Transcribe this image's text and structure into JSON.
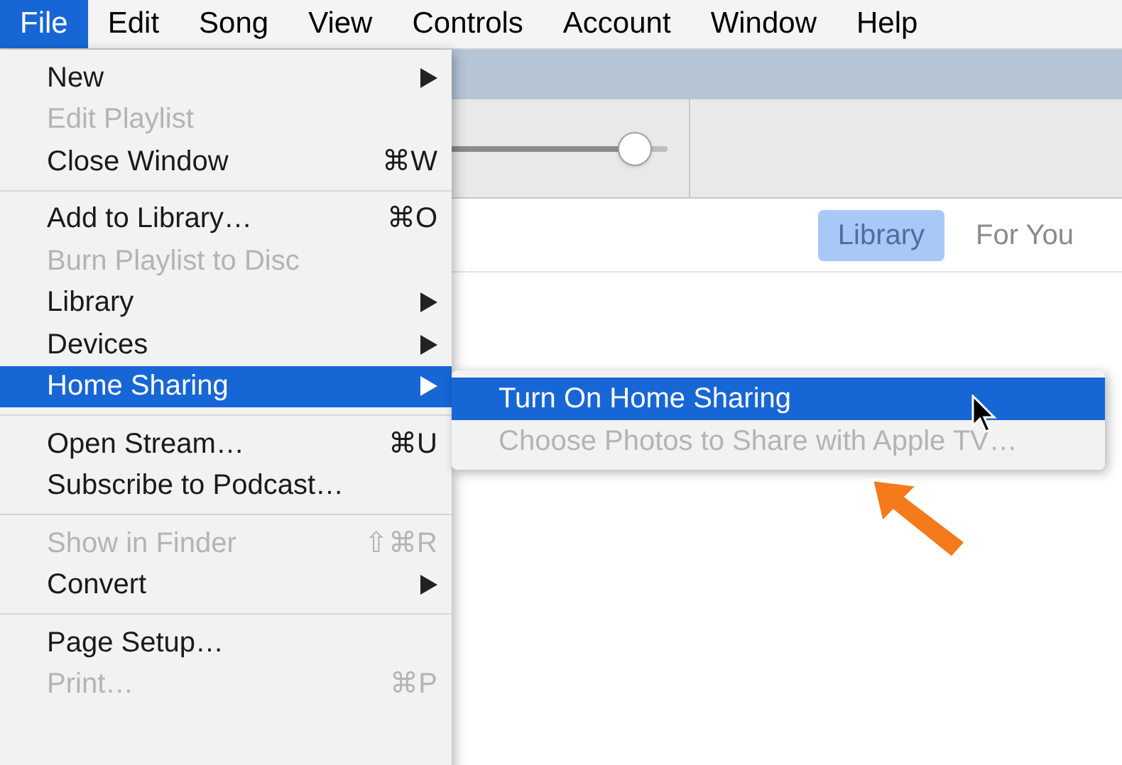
{
  "menubar": [
    {
      "label": "File",
      "selected": true
    },
    {
      "label": "Edit",
      "selected": false
    },
    {
      "label": "Song",
      "selected": false
    },
    {
      "label": "View",
      "selected": false
    },
    {
      "label": "Controls",
      "selected": false
    },
    {
      "label": "Account",
      "selected": false
    },
    {
      "label": "Window",
      "selected": false
    },
    {
      "label": "Help",
      "selected": false
    }
  ],
  "toolbar": {
    "volume": {
      "level": 0.92
    }
  },
  "tabs": [
    {
      "label": "Library",
      "selected": true
    },
    {
      "label": "For You",
      "selected": false
    }
  ],
  "file_menu": {
    "groups": [
      [
        {
          "label": "New",
          "has_submenu": true,
          "disabled": false,
          "selected": false
        },
        {
          "label": "Edit Playlist",
          "has_submenu": false,
          "disabled": true,
          "selected": false
        },
        {
          "label": "Close Window",
          "shortcut": "⌘W",
          "has_submenu": false,
          "disabled": false,
          "selected": false
        }
      ],
      [
        {
          "label": "Add to Library…",
          "shortcut": "⌘O",
          "has_submenu": false,
          "disabled": false,
          "selected": false
        },
        {
          "label": "Burn Playlist to Disc",
          "has_submenu": false,
          "disabled": true,
          "selected": false
        },
        {
          "label": "Library",
          "has_submenu": true,
          "disabled": false,
          "selected": false
        },
        {
          "label": "Devices",
          "has_submenu": true,
          "disabled": false,
          "selected": false
        },
        {
          "label": "Home Sharing",
          "has_submenu": true,
          "disabled": false,
          "selected": true
        }
      ],
      [
        {
          "label": "Open Stream…",
          "shortcut": "⌘U",
          "has_submenu": false,
          "disabled": false,
          "selected": false
        },
        {
          "label": "Subscribe to Podcast…",
          "has_submenu": false,
          "disabled": false,
          "selected": false
        }
      ],
      [
        {
          "label": "Show in Finder",
          "shortcut": "⇧⌘R",
          "has_submenu": false,
          "disabled": true,
          "selected": false
        },
        {
          "label": "Convert",
          "has_submenu": true,
          "disabled": false,
          "selected": false
        }
      ],
      [
        {
          "label": "Page Setup…",
          "has_submenu": false,
          "disabled": false,
          "selected": false
        },
        {
          "label": "Print…",
          "shortcut": "⌘P",
          "has_submenu": false,
          "disabled": true,
          "selected": false
        }
      ]
    ]
  },
  "submenu": {
    "items": [
      {
        "label": "Turn On Home Sharing",
        "disabled": false,
        "selected": true
      },
      {
        "label": "Choose Photos to Share with Apple TV…",
        "disabled": true,
        "selected": false
      }
    ]
  }
}
